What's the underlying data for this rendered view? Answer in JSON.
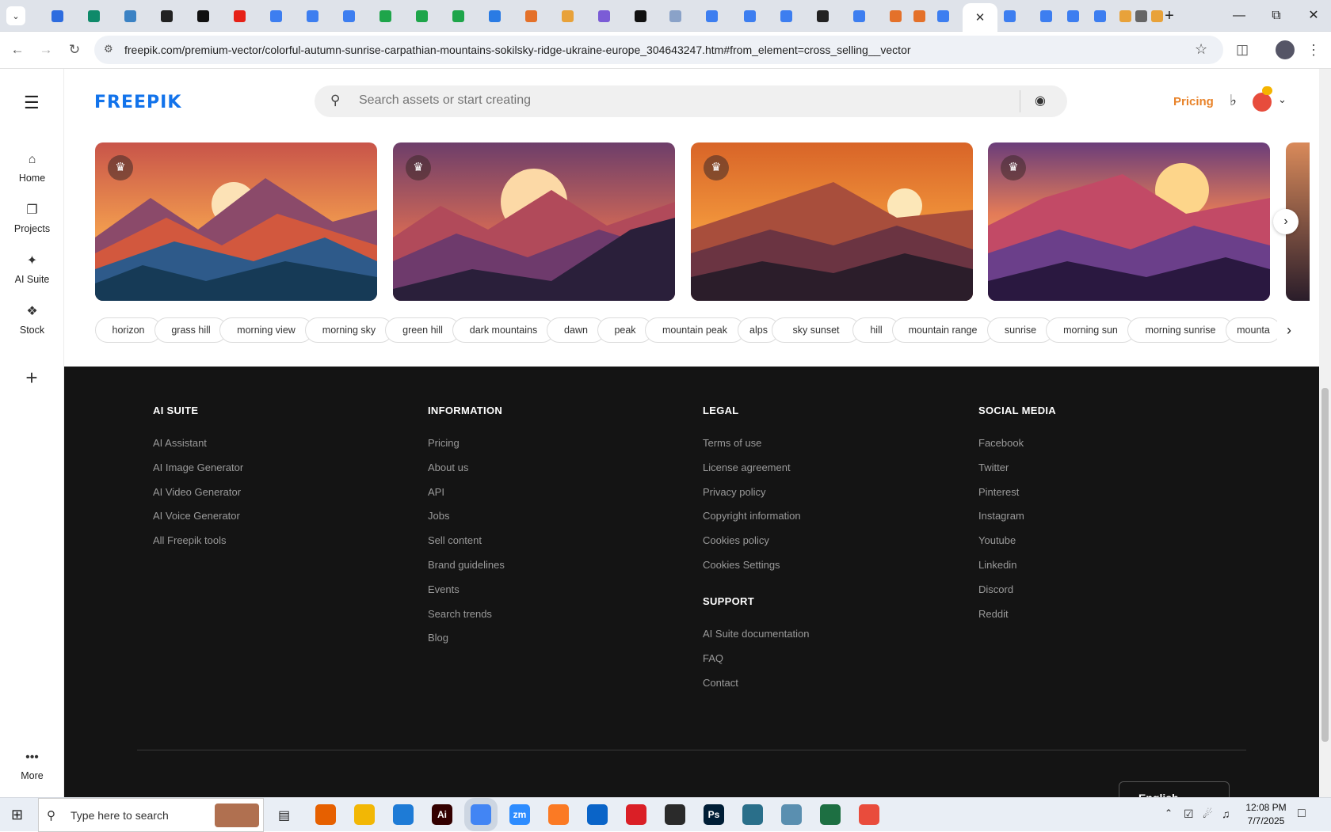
{
  "browser": {
    "active_tab_close": "✕",
    "new_tab": "+",
    "url": "freepik.com/premium-vector/colorful-autumn-sunrise-carpathian-mountains-sokilsky-ridge-ukraine-europe_304643247.htm#from_element=cross_selling__vector",
    "tab_colors": [
      "#2d6cdf",
      "#0f8a6a",
      "#3b82c4",
      "#222",
      "#111",
      "#e62117",
      "#3d7ef0",
      "#3d7ef0",
      "#3d7ef0",
      "#1ea54a",
      "#1ea54a",
      "#1ea54a",
      "#2a7be4",
      "#e4712a",
      "#e8a23a",
      "#7b5cd6",
      "#111",
      "#8aa2c8",
      "#3d7ef0",
      "#3d7ef0",
      "#3d7ef0",
      "#222",
      "#3d7ef0",
      "#e4712a",
      "#e4712a",
      "#3d7ef0",
      "#3d7ef0",
      "#3d7ef0",
      "#3d7ef0",
      "#3d7ef0",
      "#e8a23a",
      "#666",
      "#e8a23a"
    ]
  },
  "site": {
    "logo": "FREEPIK",
    "search_placeholder": "Search assets or start creating",
    "pricing": "Pricing",
    "nav": [
      {
        "label": "Home",
        "icon": "home-icon"
      },
      {
        "label": "Projects",
        "icon": "projects-icon"
      },
      {
        "label": "AI Suite",
        "icon": "ai-suite-icon"
      },
      {
        "label": "Stock",
        "icon": "stock-icon"
      }
    ],
    "more_label": "More",
    "tags": [
      "horizon",
      "grass hill",
      "morning view",
      "morning sky",
      "green hill",
      "dark mountains",
      "dawn",
      "peak",
      "mountain peak",
      "alps",
      "sky sunset",
      "hill",
      "mountain range",
      "sunrise",
      "morning sun",
      "morning sunrise",
      "mounta"
    ]
  },
  "footer": {
    "ai_suite": {
      "title": "AI SUITE",
      "links": [
        "AI Assistant",
        "AI Image Generator",
        "AI Video Generator",
        "AI Voice Generator",
        "All Freepik tools"
      ]
    },
    "information": {
      "title": "INFORMATION",
      "links": [
        "Pricing",
        "About us",
        "API",
        "Jobs",
        "Sell content",
        "Brand guidelines",
        "Events",
        "Search trends",
        "Blog"
      ]
    },
    "legal": {
      "title": "LEGAL",
      "links": [
        "Terms of use",
        "License agreement",
        "Privacy policy",
        "Copyright information",
        "Cookies policy",
        "Cookies Settings"
      ]
    },
    "support": {
      "title": "SUPPORT",
      "links": [
        "AI Suite documentation",
        "FAQ",
        "Contact"
      ]
    },
    "social": {
      "title": "SOCIAL MEDIA",
      "links": [
        "Facebook",
        "Twitter",
        "Pinterest",
        "Instagram",
        "Youtube",
        "Linkedin",
        "Discord",
        "Reddit"
      ]
    },
    "language": "English"
  },
  "taskbar": {
    "search_placeholder": "Type here to search",
    "time": "12:08 PM",
    "date": "7/7/2025"
  }
}
